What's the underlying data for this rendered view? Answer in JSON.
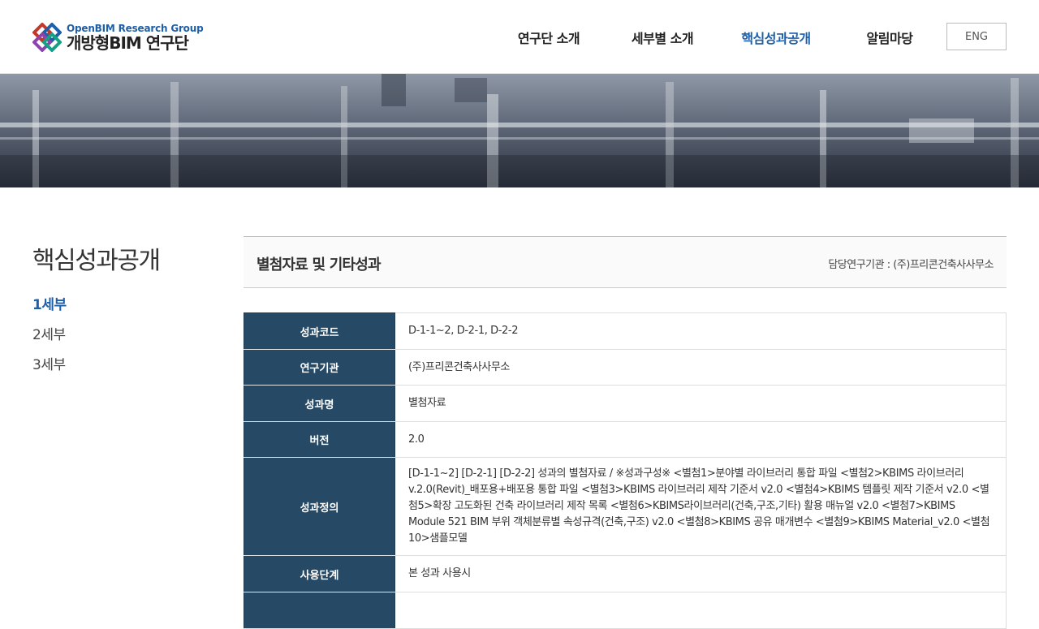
{
  "logo": {
    "en": "OpenBIM Research Group",
    "ko": "개방형BIM 연구단"
  },
  "gnb": [
    {
      "label": "연구단 소개",
      "active": false
    },
    {
      "label": "세부별 소개",
      "active": false
    },
    {
      "label": "핵심성과공개",
      "active": true
    },
    {
      "label": "알림마당",
      "active": false
    }
  ],
  "lang_button": "ENG",
  "sidebar": {
    "title": "핵심성과공개",
    "items": [
      {
        "label": "1세부",
        "active": true
      },
      {
        "label": "2세부",
        "active": false
      },
      {
        "label": "3세부",
        "active": false
      }
    ]
  },
  "content": {
    "title": "별첨자료 및 기타성과",
    "org": "담당연구기관 : (주)프리콘건축사사무소"
  },
  "table": {
    "rows": [
      {
        "label": "성과코드",
        "value": "D-1-1~2, D-2-1, D-2-2"
      },
      {
        "label": "연구기관",
        "value": "(주)프리콘건축사사무소"
      },
      {
        "label": "성과명",
        "value": "별첨자료"
      },
      {
        "label": "버전",
        "value": "2.0"
      },
      {
        "label": "성과정의",
        "value": "[D-1-1~2] [D-2-1] [D-2-2] 성과의 별첨자료 / ※성과구성※ <별첨1>분야별 라이브러리 통합 파일 <별첨2>KBIMS 라이브러리 v.2.0(Revit)_배포용+배포용 통합 파일 <별첨3>KBIMS 라이브러리 제작 기준서 v2.0 <별첨4>KBIMS 템플릿 제작 기준서 v2.0 <별첨5>확장 고도화된 건축 라이브러리 제작 목록 <별첨6>KBIMS라이브러리(건축,구조,기타) 활용 매뉴얼 v2.0 <별첨7>KBIMS Module 521 BIM 부위 객체분류별 속성규격(건축,구조) v2.0 <별첨8>KBIMS 공유 매개변수 <별첨9>KBIMS Material_v2.0 <별첨10>샘플모델"
      },
      {
        "label": "사용단계",
        "value": "본 성과 사용시"
      }
    ]
  },
  "colors": {
    "accent": "#1d5fa8",
    "table_header": "#264a66"
  }
}
